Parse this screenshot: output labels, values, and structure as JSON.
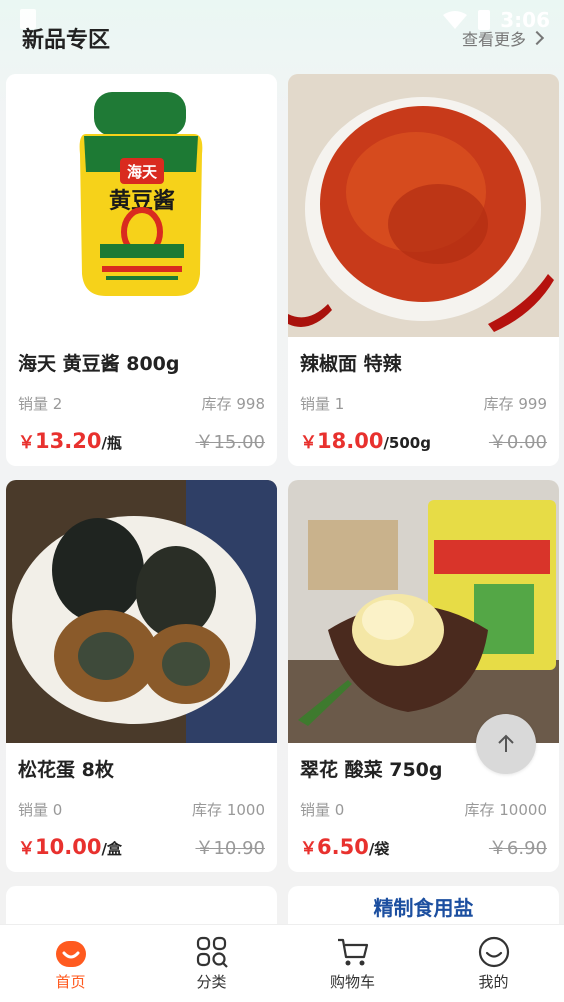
{
  "status_bar": {
    "time": "3:06"
  },
  "section": {
    "title": "新品专区",
    "more_label": "查看更多"
  },
  "products": [
    {
      "name": "海天 黄豆酱 800g",
      "sales_label": "销量 2",
      "stock_label": "库存 998",
      "currency": "￥",
      "price": "13.20",
      "unit": "/瓶",
      "old_price": "￥15.00",
      "image": "haitian-soybean-paste-jar"
    },
    {
      "name": "辣椒面 特辣",
      "sales_label": "销量 1",
      "stock_label": "库存 999",
      "currency": "￥",
      "price": "18.00",
      "unit": "/500g",
      "old_price": "￥0.00",
      "image": "chili-flakes-bowl"
    },
    {
      "name": "松花蛋 8枚",
      "sales_label": "销量 0",
      "stock_label": "库存 1000",
      "currency": "￥",
      "price": "10.00",
      "unit": "/盒",
      "old_price": "￥10.90",
      "image": "century-eggs-plate"
    },
    {
      "name": "翠花 酸菜 750g",
      "sales_label": "销量 0",
      "stock_label": "库存 10000",
      "currency": "￥",
      "price": "6.50",
      "unit": "/袋",
      "old_price": "￥6.90",
      "image": "cuihua-pickled-cabbage"
    }
  ],
  "partial_card_text": "精制食用盐",
  "tabs": [
    {
      "label": "首页",
      "icon": "home-bag-icon",
      "active": true
    },
    {
      "label": "分类",
      "icon": "category-grid-icon",
      "active": false
    },
    {
      "label": "购物车",
      "icon": "cart-icon",
      "active": false
    },
    {
      "label": "我的",
      "icon": "smile-profile-icon",
      "active": false
    }
  ],
  "colors": {
    "accent": "#ff5a1f",
    "price_red": "#e8312e"
  }
}
